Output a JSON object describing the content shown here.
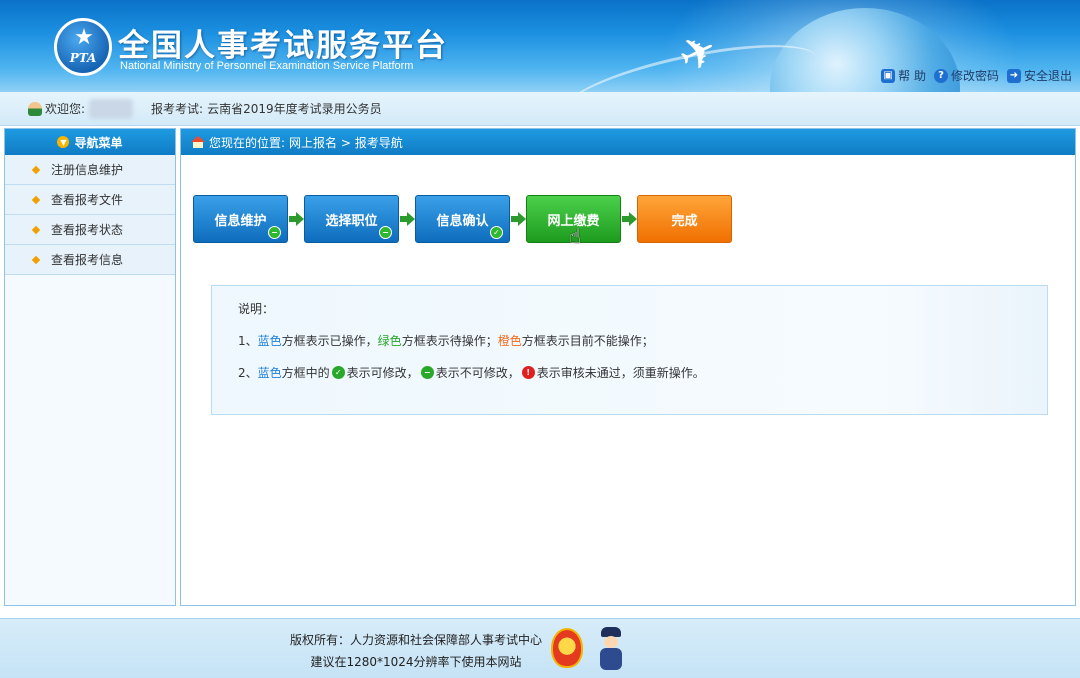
{
  "header": {
    "title_cn": "全国人事考试服务平台",
    "title_en": "National Ministry of Personnel Examination Service Platform",
    "logo_text": "PTA",
    "links": [
      {
        "label": "帮 助",
        "icon": "lock-icon"
      },
      {
        "label": "修改密码",
        "icon": "question-icon"
      },
      {
        "label": "安全退出",
        "icon": "exit-icon"
      }
    ]
  },
  "welcome": {
    "label": "欢迎您:",
    "exam_label": "报考考试:",
    "exam_name": "云南省2019年度考试录用公务员"
  },
  "sidebar": {
    "title": "导航菜单",
    "items": [
      {
        "label": "注册信息维护"
      },
      {
        "label": "查看报考文件"
      },
      {
        "label": "查看报考状态"
      },
      {
        "label": "查看报考信息"
      }
    ]
  },
  "breadcrumb": {
    "prefix": "您现在的位置:",
    "path": "网上报名 > 报考导航"
  },
  "steps": [
    {
      "label": "信息维护",
      "color": "blue"
    },
    {
      "label": "选择职位",
      "color": "blue"
    },
    {
      "label": "信息确认",
      "color": "blue"
    },
    {
      "label": "网上缴费",
      "color": "green"
    },
    {
      "label": "完成",
      "color": "orange"
    }
  ],
  "info": {
    "heading": "说明：",
    "line1": {
      "n": "1、",
      "blue": "蓝色",
      "t1": "方框表示已操作，",
      "green": "绿色",
      "t2": "方框表示待操作；",
      "orange": "橙色",
      "t3": "方框表示目前不能操作；"
    },
    "line2": {
      "n": "2、",
      "blue": "蓝色",
      "t1": "方框中的",
      "t2": "表示可修改，",
      "t3": "表示不可修改，",
      "t4": "表示审核未通过，须重新操作。"
    }
  },
  "footer": {
    "line1": "版权所有：人力资源和社会保障部人事考试中心",
    "line2": "建议在1280*1024分辨率下使用本网站"
  },
  "colors": {
    "primary_blue": "#0f7cc6",
    "step_blue": "#0e6dbd",
    "step_green": "#1d9b1d",
    "step_orange": "#f07000"
  }
}
